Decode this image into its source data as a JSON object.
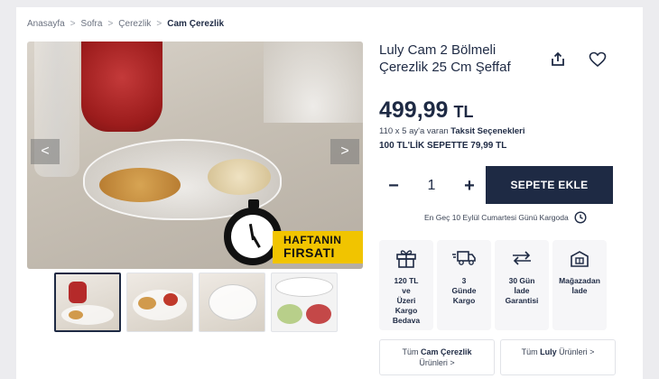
{
  "breadcrumb": {
    "items": [
      "Anasayfa",
      "Sofra",
      "Çerezlik"
    ],
    "current": "Cam Çerezlik",
    "separator": ">"
  },
  "product": {
    "title": "Luly Cam 2 Bölmeli Çerezlik 25 Cm Şeffaf",
    "price_amount": "499,99",
    "price_currency": "TL",
    "installment_prefix": "110 x 5 ay'a varan",
    "installment_link": "Taksit Seçenekleri",
    "promo": "100 TL'LİK SEPETTE 79,99 TL",
    "badge_line1": "HAFTANIN",
    "badge_line2": "FIRSATI"
  },
  "gallery": {
    "prev_arrow": "<",
    "next_arrow": ">",
    "thumbnail_count": 4,
    "active_index": 0
  },
  "quantity": {
    "minus": "−",
    "plus": "+",
    "value": "1"
  },
  "cart": {
    "add_label": "SEPETE EKLE"
  },
  "shipping_text": "En Geç 10 Eylül Cumartesi Günü Kargoda",
  "features": [
    {
      "icon": "gift-icon",
      "text": "120 TL\nve\nÜzeri\nKargo\nBedava"
    },
    {
      "icon": "truck-icon",
      "text": "3\nGünde\nKargo"
    },
    {
      "icon": "return-arrows-icon",
      "text": "30 Gün\nİade\nGarantisi"
    },
    {
      "icon": "store-return-icon",
      "text": "Mağazadan\nİade"
    }
  ],
  "links": {
    "category_prefix": "Tüm",
    "category_name": "Cam Çerezlik",
    "category_suffix": "Ürünleri >",
    "brand_prefix": "Tüm",
    "brand_name": "Luly",
    "brand_suffix": "Ürünleri >"
  },
  "colors": {
    "navy": "#1e2a44",
    "badge_yellow": "#f1c400"
  }
}
